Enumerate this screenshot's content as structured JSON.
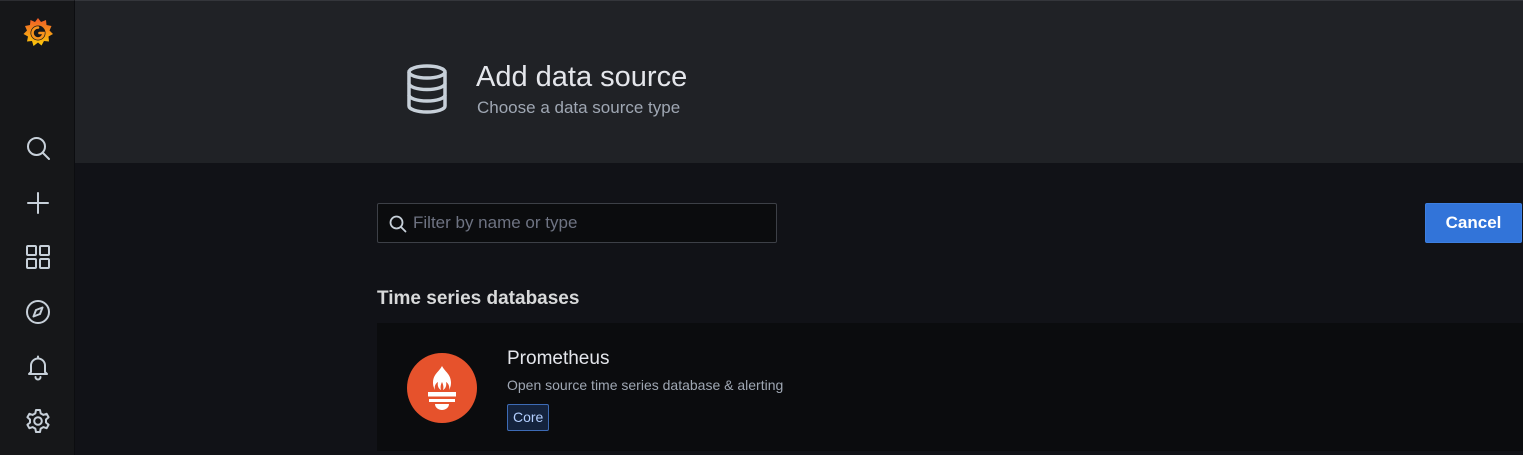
{
  "sidebar": {
    "logo": "grafana-logo",
    "items": [
      {
        "icon": "search-icon"
      },
      {
        "icon": "plus-icon"
      },
      {
        "icon": "dashboards-icon"
      },
      {
        "icon": "explore-compass-icon"
      },
      {
        "icon": "alerting-bell-icon"
      },
      {
        "icon": "gear-icon"
      }
    ]
  },
  "header": {
    "icon": "database-icon",
    "title": "Add data source",
    "subtitle": "Choose a data source type"
  },
  "search": {
    "placeholder": "Filter by name or type",
    "value": ""
  },
  "actions": {
    "cancel_label": "Cancel"
  },
  "sections": [
    {
      "heading": "Time series databases",
      "items": [
        {
          "name": "Prometheus",
          "description": "Open source time series database & alerting",
          "badge": "Core",
          "logo": "prometheus-logo"
        }
      ]
    }
  ],
  "colors": {
    "primary_button": "#3274d9",
    "prometheus": "#e6522c",
    "background": "#111217",
    "header_bg": "#202226"
  }
}
